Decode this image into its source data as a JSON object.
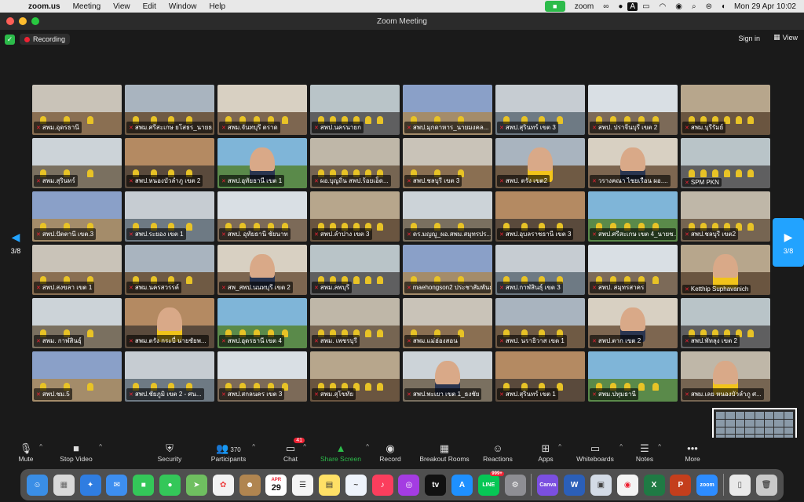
{
  "menubar": {
    "app": "zoom.us",
    "items": [
      "Meeting",
      "View",
      "Edit",
      "Window",
      "Help"
    ],
    "tray_zoom": "zoom",
    "tray_input": "A",
    "datetime": "Mon 29 Apr  10:02"
  },
  "window": {
    "title": "Zoom Meeting"
  },
  "meeting": {
    "recording": "Recording",
    "sign_in": "Sign in",
    "view": "View",
    "page": "3/8"
  },
  "tiles": [
    {
      "label": "สพม.อุดรธานี"
    },
    {
      "label": "สพม.ศรีสะเกษ ยโสธร_นายธ..."
    },
    {
      "label": "สพม.จันทบุรี ตราด"
    },
    {
      "label": "สพป.นครนายก"
    },
    {
      "label": "สพป.มุกดาหาร_นายมงคล..."
    },
    {
      "label": "สพป.สุรินทร์ เขต 3"
    },
    {
      "label": "สพป. ปราจีนบุรี เขต 2"
    },
    {
      "label": "สพม.บุรีรัมย์"
    },
    {
      "label": "สพม.สุรินทร์"
    },
    {
      "label": "สพป.หนองบัวลำภู เขต 2"
    },
    {
      "label": "สพป.อุทัยธานี เขต 1"
    },
    {
      "label": "ผอ.บุญถิ่น สพป.ร้อยเอ็ด..."
    },
    {
      "label": "สพป.ชลบุรี เขต 3"
    },
    {
      "label": "สพป. ตรัง เขต2"
    },
    {
      "label": "วรางคณา ไชยเรือน ผอ...."
    },
    {
      "label": "SPM PKN"
    },
    {
      "label": "สพป.ปัตตานี เขต.3"
    },
    {
      "label": "สพป.ระยอง เขต 1"
    },
    {
      "label": "สพป. อุทัยธานี ชัยนาท"
    },
    {
      "label": "สพป.ลำปาง เขต 3"
    },
    {
      "label": "ดร.มญญู_ผอ.สพม.สมุทรปร..."
    },
    {
      "label": "สพป.อุบลราชธานี เขต 3"
    },
    {
      "label": "สพป.ศรีสะเกษ เขต 4_นายช..."
    },
    {
      "label": "สพป.ชลบุรี เขต2"
    },
    {
      "label": "สพป.สงขลา เขต 1"
    },
    {
      "label": "สพม.นครสวรรค์"
    },
    {
      "label": "สพ_สพป.นนทบุรี เขต 2"
    },
    {
      "label": "สพม.ลพบุรี"
    },
    {
      "label": "maehongson2 ประชาสัมพันธ์"
    },
    {
      "label": "สพป.กาฬสินธุ์ เขต 3"
    },
    {
      "label": "สพป. สมุทรสาคร"
    },
    {
      "label": "Ketthip Suphavanich"
    },
    {
      "label": "สพม. กาฬสินธุ์"
    },
    {
      "label": "สพม.ตรัง กระบี่ นายชัยพ..."
    },
    {
      "label": "สพป.อุดรธานี เขต 4"
    },
    {
      "label": "สพม. เพชรบุรี"
    },
    {
      "label": "สพม.แม่ฮ่องสอน"
    },
    {
      "label": "สพป. นราธิวาส เขต 1"
    },
    {
      "label": "สพป.ตาก เขต 2"
    },
    {
      "label": "สพป.พัทลุง เขต 2"
    },
    {
      "label": "สพป.ชม.5"
    },
    {
      "label": "สพป.ชัยภูมิ เขต 2 - ศน..."
    },
    {
      "label": "สพป.สกลนคร เขต 3"
    },
    {
      "label": "สพม.สุโขทัย"
    },
    {
      "label": "สพป.พะเยา เขต 1_ธงชัย"
    },
    {
      "label": "สพป.สุรินทร์ เขต 1"
    },
    {
      "label": "สพม.ปทุมธานี"
    },
    {
      "label": "สพม.เลย หนองบัวลำภู ศ..."
    }
  ],
  "toolbar": {
    "mute": "Mute",
    "stop_video": "Stop Video",
    "security": "Security",
    "participants": "Participants",
    "participants_count": "370",
    "chat": "Chat",
    "chat_badge": "41",
    "share_screen": "Share Screen",
    "record": "Record",
    "breakout_rooms": "Breakout Rooms",
    "reactions": "Reactions",
    "apps": "Apps",
    "whiteboards": "Whiteboards",
    "notes": "Notes",
    "more": "More"
  },
  "dock": {
    "calendar_month": "APR",
    "calendar_day": "29",
    "line_badge": "999+",
    "canva": "Canva",
    "zoom": "zoom"
  }
}
